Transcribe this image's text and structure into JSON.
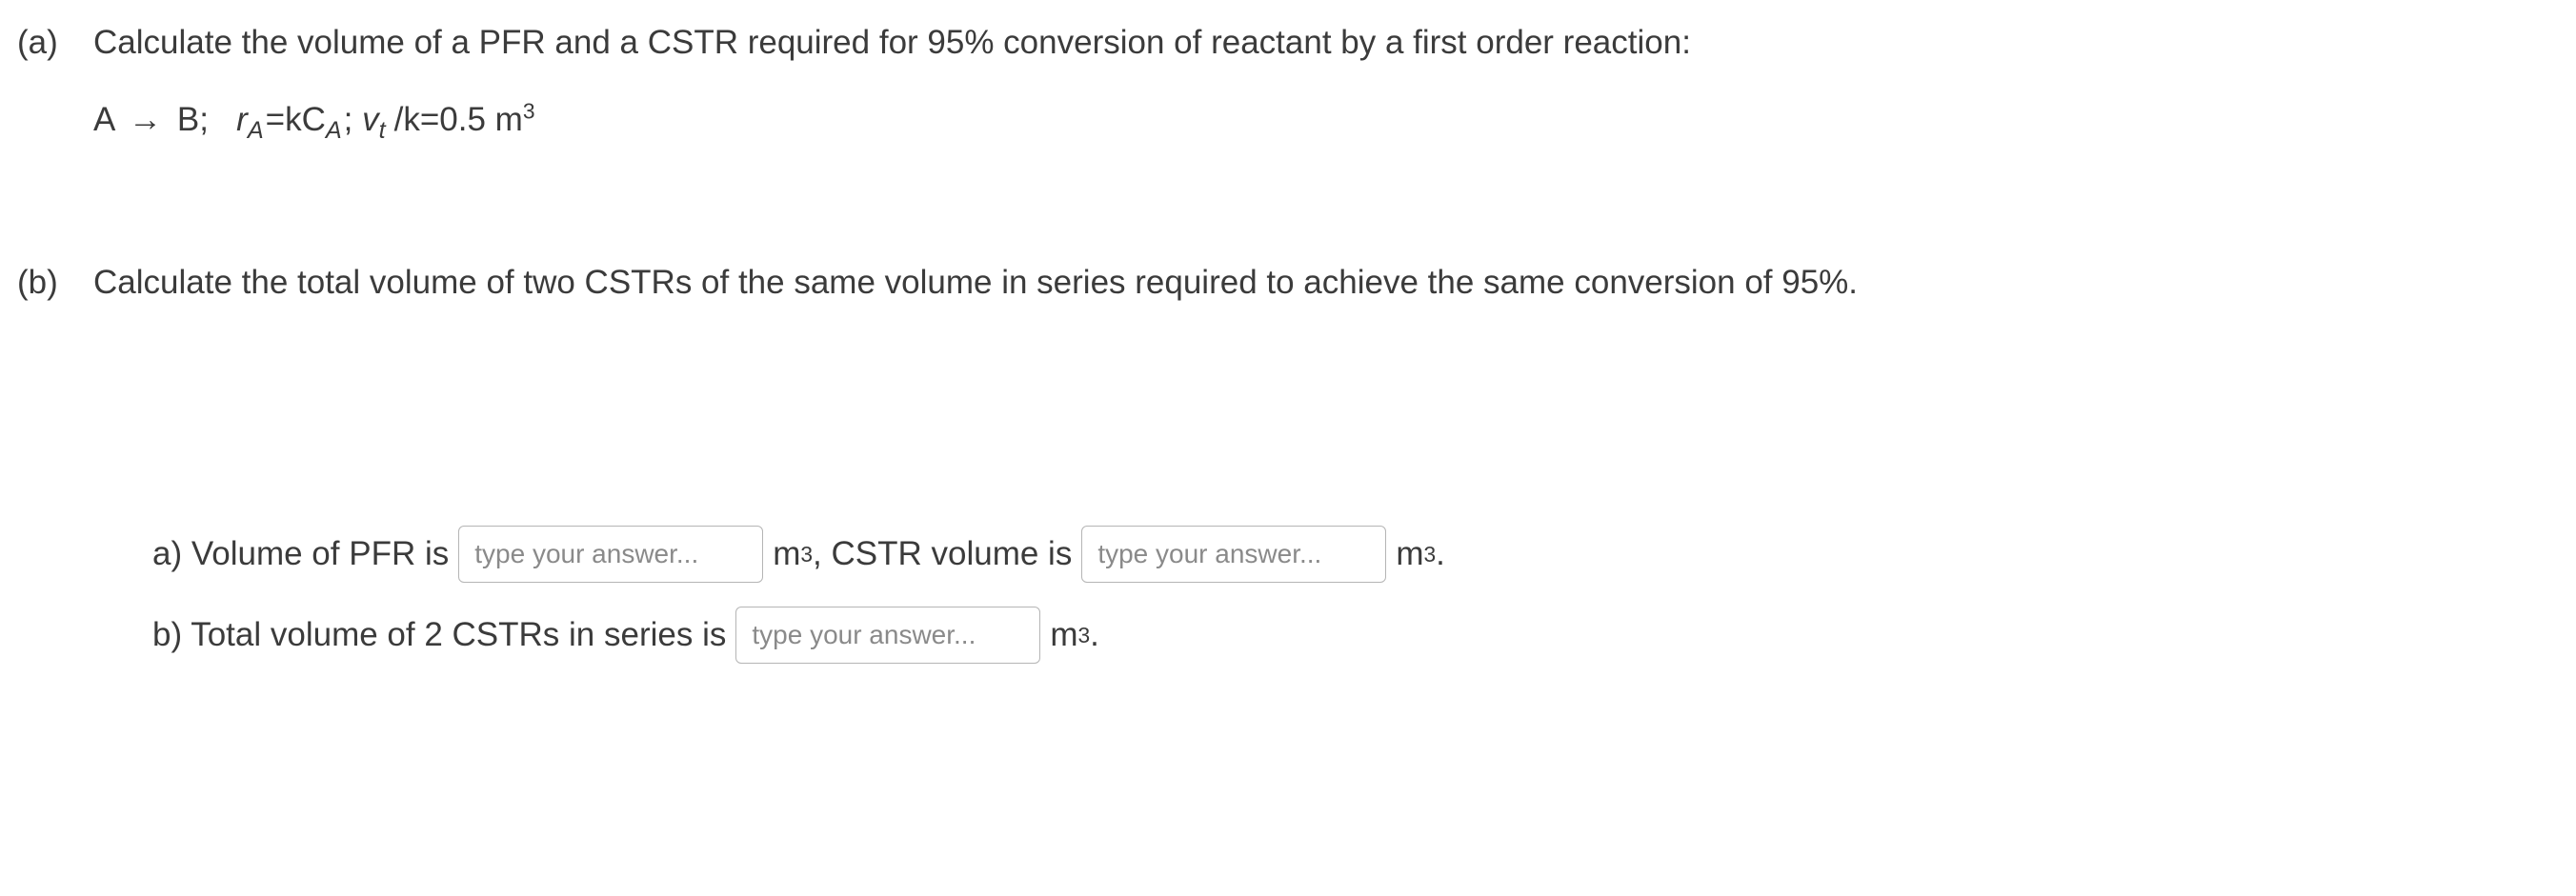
{
  "partA": {
    "label": "(a)",
    "text": "Calculate the volume of a PFR and a CSTR required for 95% conversion of reactant by a first order reaction:",
    "eq_lhs_A": "A",
    "eq_arrow": "→",
    "eq_rhs_B": "B;",
    "eq_r": "r",
    "eq_r_sub": "A",
    "eq_eqkC": "=kC",
    "eq_C_sub": "A",
    "eq_semi": "; ",
    "eq_v": "v",
    "eq_v_sub": "t ",
    "eq_over_k": "/k=0.5 m",
    "eq_m_exp": "3"
  },
  "partB": {
    "label": "(b)",
    "text": "Calculate the total volume of two CSTRs of the same volume in series required to achieve the same conversion of 95%."
  },
  "answers": {
    "a_prefix": "a) Volume of PFR is",
    "a_mid": ", CSTR volume is",
    "b_prefix": "b) Total volume of 2 CSTRs in series is",
    "unit_m": "m",
    "unit_exp": "3",
    "unit_period": ".",
    "placeholder": "type your answer..."
  }
}
